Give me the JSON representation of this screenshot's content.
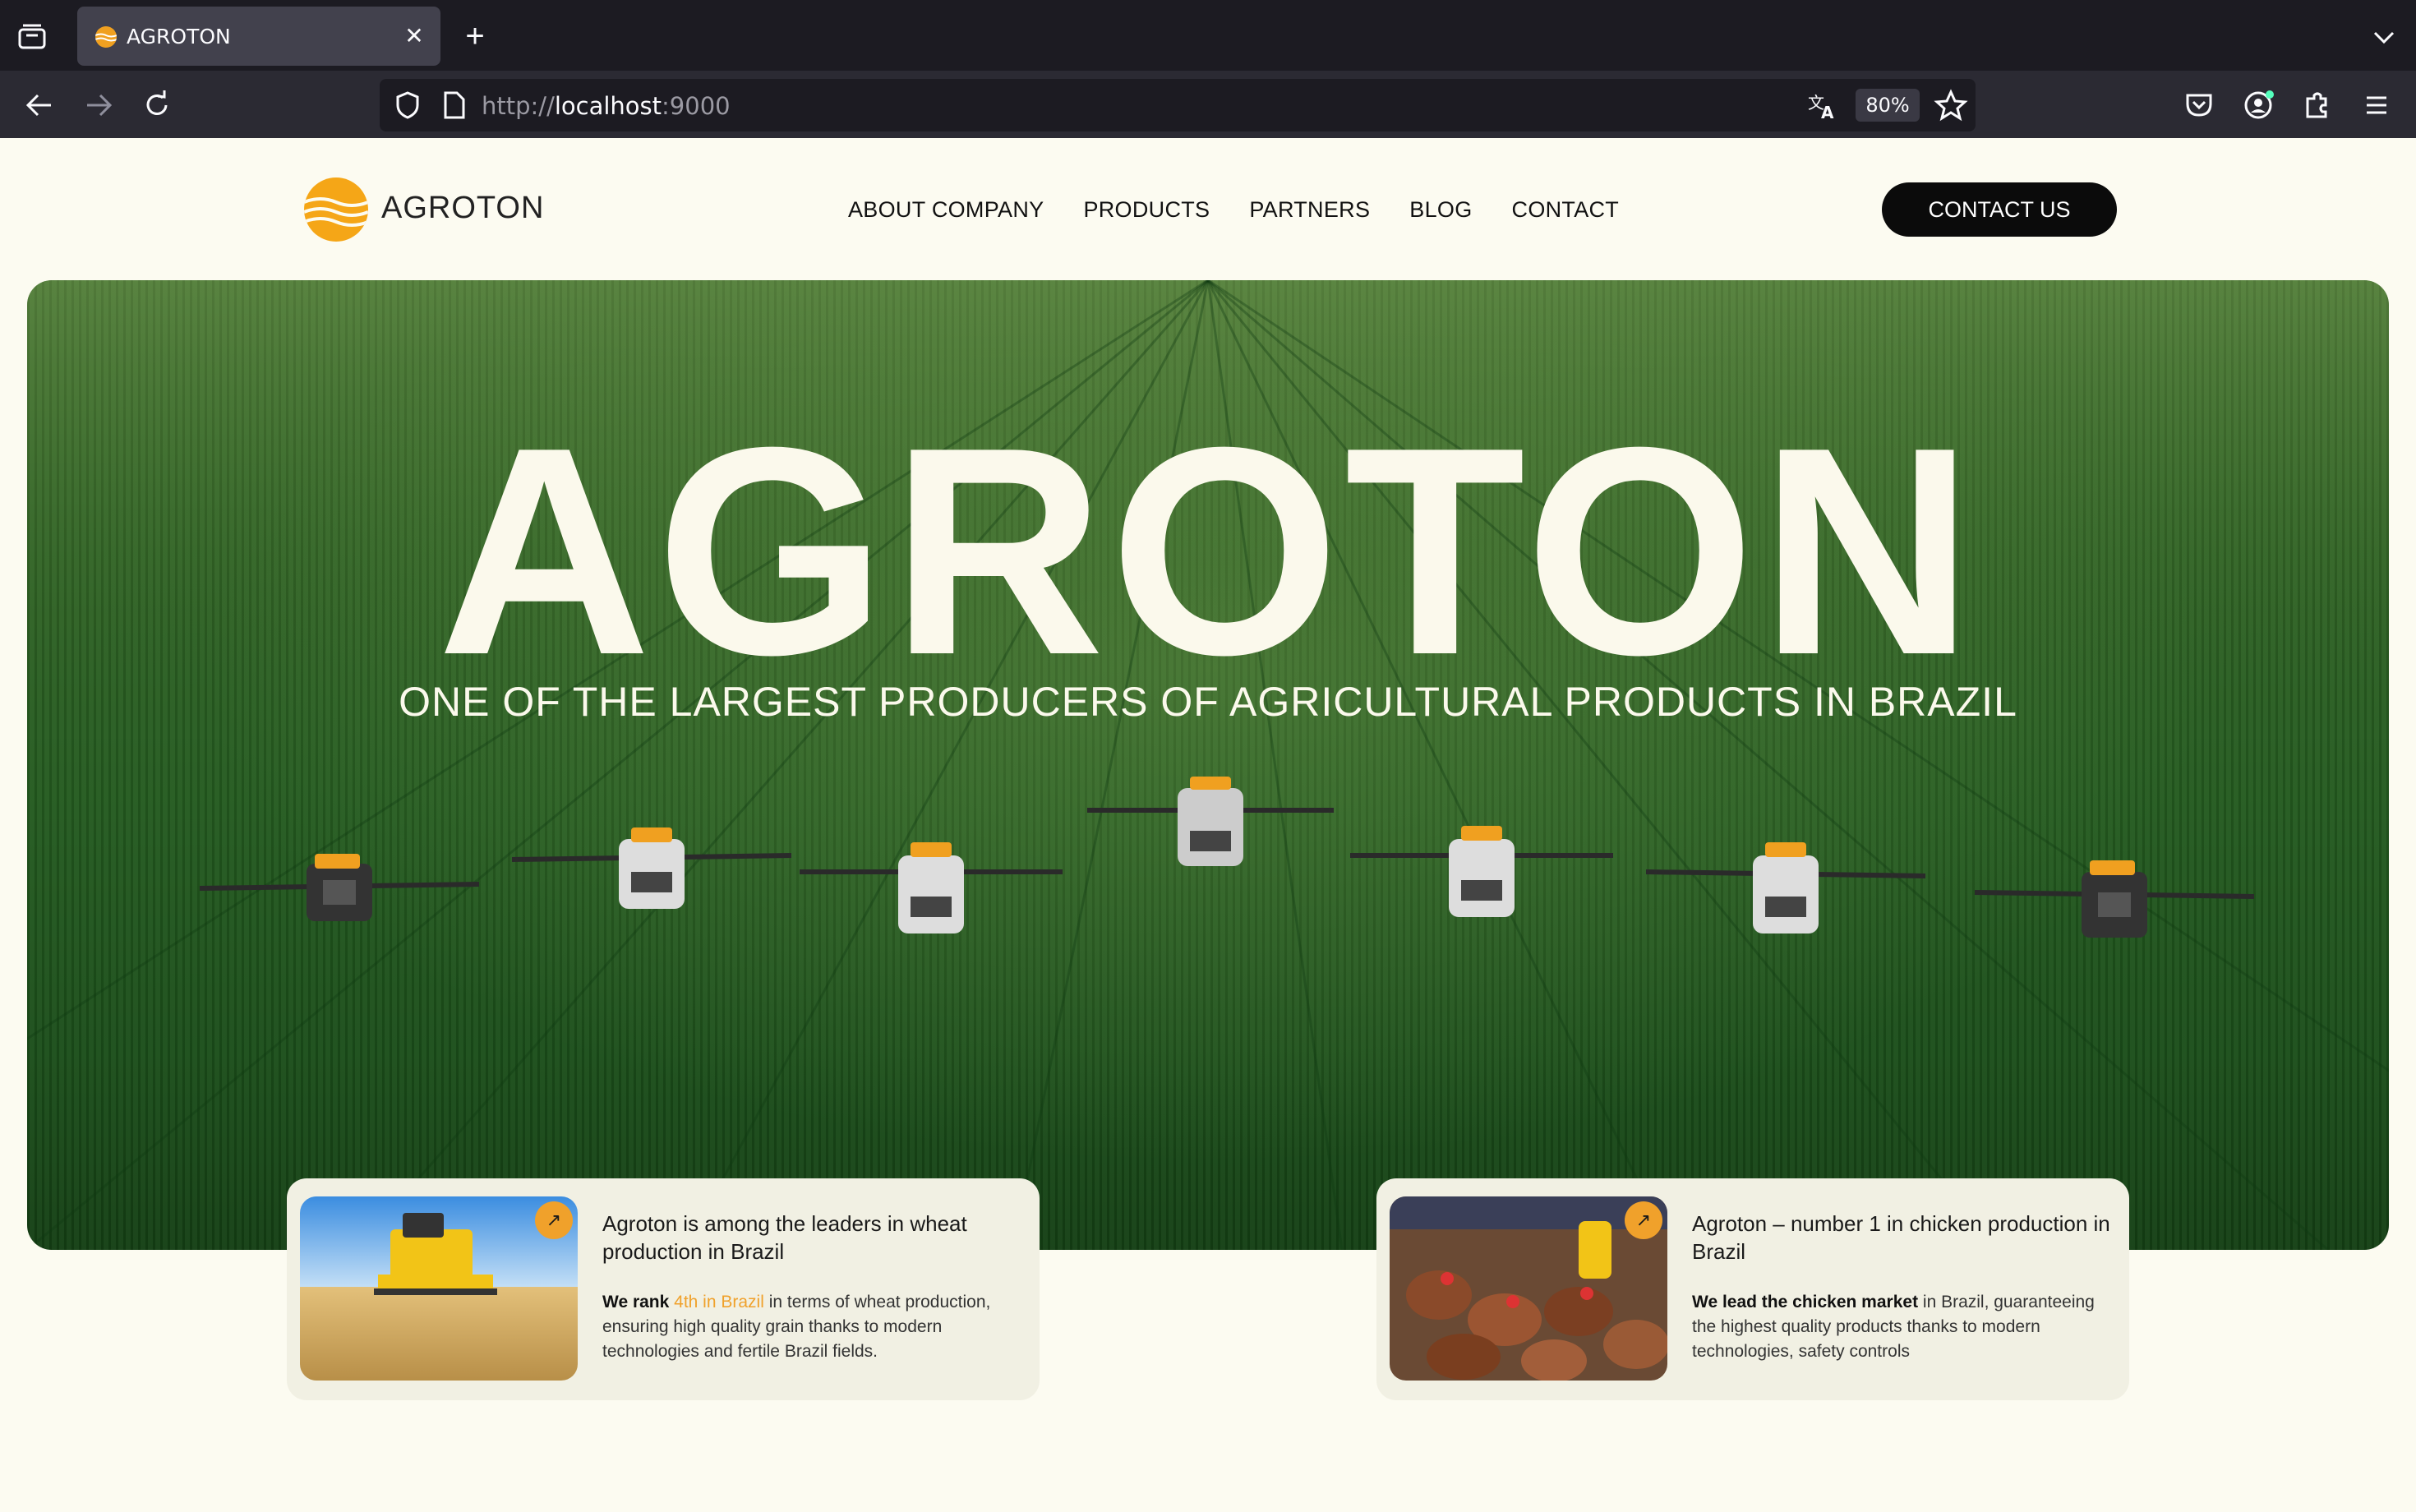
{
  "browser": {
    "tab_title": "AGROTON",
    "tab_close": "✕",
    "new_tab": "+",
    "url_scheme": "http://",
    "url_host": "localhost",
    "url_port": ":9000",
    "zoom": "80%"
  },
  "header": {
    "logo_text": "AGROTON",
    "nav": [
      "ABOUT COMPANY",
      "PRODUCTS",
      "PARTNERS",
      "BLOG",
      "CONTACT"
    ],
    "cta": "CONTACT US"
  },
  "hero": {
    "title": "AGROTON",
    "subtitle": "ONE OF THE LARGEST PRODUCERS OF AGRICULTURAL PRODUCTS IN BRAZIL"
  },
  "cards": [
    {
      "arrow": "↗",
      "title": "Agroton is among the leaders in wheat production in Brazil",
      "body_bold": "We rank ",
      "body_highlight": "4th in Brazil",
      "body_rest": " in terms of wheat production, ensuring high quality grain thanks to modern technologies and fertile Brazil fields."
    },
    {
      "arrow": "↗",
      "title": "Agroton – number 1 in chicken production in Brazil",
      "body_bold": "We lead the chicken market",
      "body_highlight": "",
      "body_rest": " in Brazil, guaranteeing the highest quality products thanks to modern technologies, safety controls"
    }
  ],
  "colors": {
    "accent": "#f0a12b",
    "page_bg": "#fcfbf1",
    "card_bg": "#f1f0e3",
    "button_bg": "#0b0b0b",
    "hero_text": "#fbf9ec"
  },
  "icons": {
    "tab_list": "tab-list-icon",
    "back": "back-arrow-icon",
    "forward": "forward-arrow-icon",
    "reload": "reload-icon",
    "tracking": "shield-icon",
    "page": "page-icon",
    "translate": "translate-icon",
    "bookmark": "star-icon",
    "pocket": "pocket-icon",
    "account": "account-icon",
    "extensions": "puzzle-icon",
    "menu": "hamburger-menu-icon",
    "overflow": "chevron-down-icon"
  }
}
